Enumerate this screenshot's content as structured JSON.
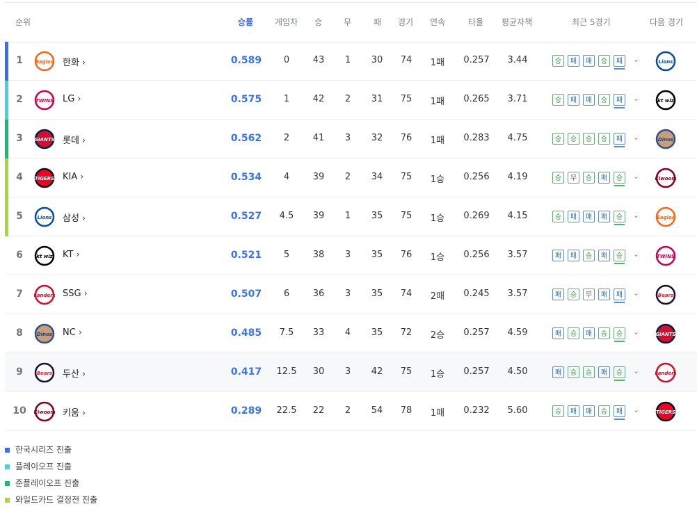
{
  "headers": {
    "rank": "순위",
    "pct": "승률",
    "gb": "게임차",
    "w": "승",
    "d": "무",
    "l": "패",
    "games": "경기",
    "streak": "연속",
    "avg": "타율",
    "era": "평균자책",
    "recent": "최근 5경기",
    "next": "다음 경기"
  },
  "colors": {
    "ks": "#3f6fe0",
    "po": "#4fd0d8",
    "jpo": "#22b573",
    "wc": "#a6d64b",
    "accent": "#3b74e6"
  },
  "recent_labels": {
    "W": "승",
    "L": "패",
    "D": "무"
  },
  "teams": [
    {
      "rank": "1",
      "name": "한화",
      "logo": "eagles-logo-icon",
      "pct": "0.589",
      "gb": "0",
      "w": "43",
      "d": "1",
      "l": "30",
      "g": "74",
      "streak": "1패",
      "avg": "0.257",
      "era": "3.44",
      "recent": [
        "W",
        "L",
        "L",
        "W",
        "L"
      ],
      "next": "lions-logo-icon",
      "status": "ks"
    },
    {
      "rank": "2",
      "name": "LG",
      "logo": "twins-logo-icon",
      "pct": "0.575",
      "gb": "1",
      "w": "42",
      "d": "2",
      "l": "31",
      "g": "75",
      "streak": "1패",
      "avg": "0.265",
      "era": "3.71",
      "recent": [
        "W",
        "L",
        "L",
        "W",
        "L"
      ],
      "next": "ktwiz-logo-icon",
      "status": "po"
    },
    {
      "rank": "3",
      "name": "롯데",
      "logo": "giants-logo-icon",
      "pct": "0.562",
      "gb": "2",
      "w": "41",
      "d": "3",
      "l": "32",
      "g": "76",
      "streak": "1패",
      "avg": "0.283",
      "era": "4.75",
      "recent": [
        "W",
        "W",
        "W",
        "W",
        "L"
      ],
      "next": "dinos-logo-icon",
      "status": "jpo"
    },
    {
      "rank": "4",
      "name": "KIA",
      "logo": "tigers-logo-icon",
      "pct": "0.534",
      "gb": "4",
      "w": "39",
      "d": "2",
      "l": "34",
      "g": "75",
      "streak": "1승",
      "avg": "0.256",
      "era": "4.19",
      "recent": [
        "W",
        "D",
        "W",
        "L",
        "W"
      ],
      "next": "heroes-logo-icon",
      "status": "wc"
    },
    {
      "rank": "5",
      "name": "삼성",
      "logo": "lions-logo-icon",
      "pct": "0.527",
      "gb": "4.5",
      "w": "39",
      "d": "1",
      "l": "35",
      "g": "75",
      "streak": "1승",
      "avg": "0.269",
      "era": "4.15",
      "recent": [
        "W",
        "L",
        "L",
        "L",
        "W"
      ],
      "next": "eagles-logo-icon",
      "status": "wc"
    },
    {
      "rank": "6",
      "name": "KT",
      "logo": "ktwiz-logo-icon",
      "pct": "0.521",
      "gb": "5",
      "w": "38",
      "d": "3",
      "l": "35",
      "g": "76",
      "streak": "1승",
      "avg": "0.256",
      "era": "3.57",
      "recent": [
        "L",
        "L",
        "W",
        "L",
        "W"
      ],
      "next": "twins-logo-icon",
      "status": ""
    },
    {
      "rank": "7",
      "name": "SSG",
      "logo": "landers-logo-icon",
      "pct": "0.507",
      "gb": "6",
      "w": "36",
      "d": "3",
      "l": "35",
      "g": "74",
      "streak": "2패",
      "avg": "0.245",
      "era": "3.57",
      "recent": [
        "L",
        "W",
        "D",
        "L",
        "L"
      ],
      "next": "bears-logo-icon",
      "status": ""
    },
    {
      "rank": "8",
      "name": "NC",
      "logo": "dinos-logo-icon",
      "pct": "0.485",
      "gb": "7.5",
      "w": "33",
      "d": "4",
      "l": "35",
      "g": "72",
      "streak": "2승",
      "avg": "0.257",
      "era": "4.59",
      "recent": [
        "L",
        "W",
        "L",
        "W",
        "W"
      ],
      "next": "giants-logo-icon",
      "status": ""
    },
    {
      "rank": "9",
      "name": "두산",
      "logo": "bears-logo-icon",
      "pct": "0.417",
      "gb": "12.5",
      "w": "30",
      "d": "3",
      "l": "42",
      "g": "75",
      "streak": "1승",
      "avg": "0.257",
      "era": "4.50",
      "recent": [
        "L",
        "W",
        "W",
        "L",
        "W"
      ],
      "next": "landers-logo-icon",
      "status": ""
    },
    {
      "rank": "10",
      "name": "키움",
      "logo": "heroes-logo-icon",
      "pct": "0.289",
      "gb": "22.5",
      "w": "22",
      "d": "2",
      "l": "54",
      "g": "78",
      "streak": "1패",
      "avg": "0.232",
      "era": "5.60",
      "recent": [
        "W",
        "L",
        "L",
        "W",
        "L"
      ],
      "next": "tigers-logo-icon",
      "status": ""
    }
  ],
  "legend": [
    {
      "label": "한국시리즈 진출",
      "color": "#3f6fe0"
    },
    {
      "label": "플레이오프 진출",
      "color": "#4fd0d8"
    },
    {
      "label": "준플레이오프 진출",
      "color": "#22b573"
    },
    {
      "label": "와일드카드 결정전 진출",
      "color": "#a6d64b"
    }
  ]
}
